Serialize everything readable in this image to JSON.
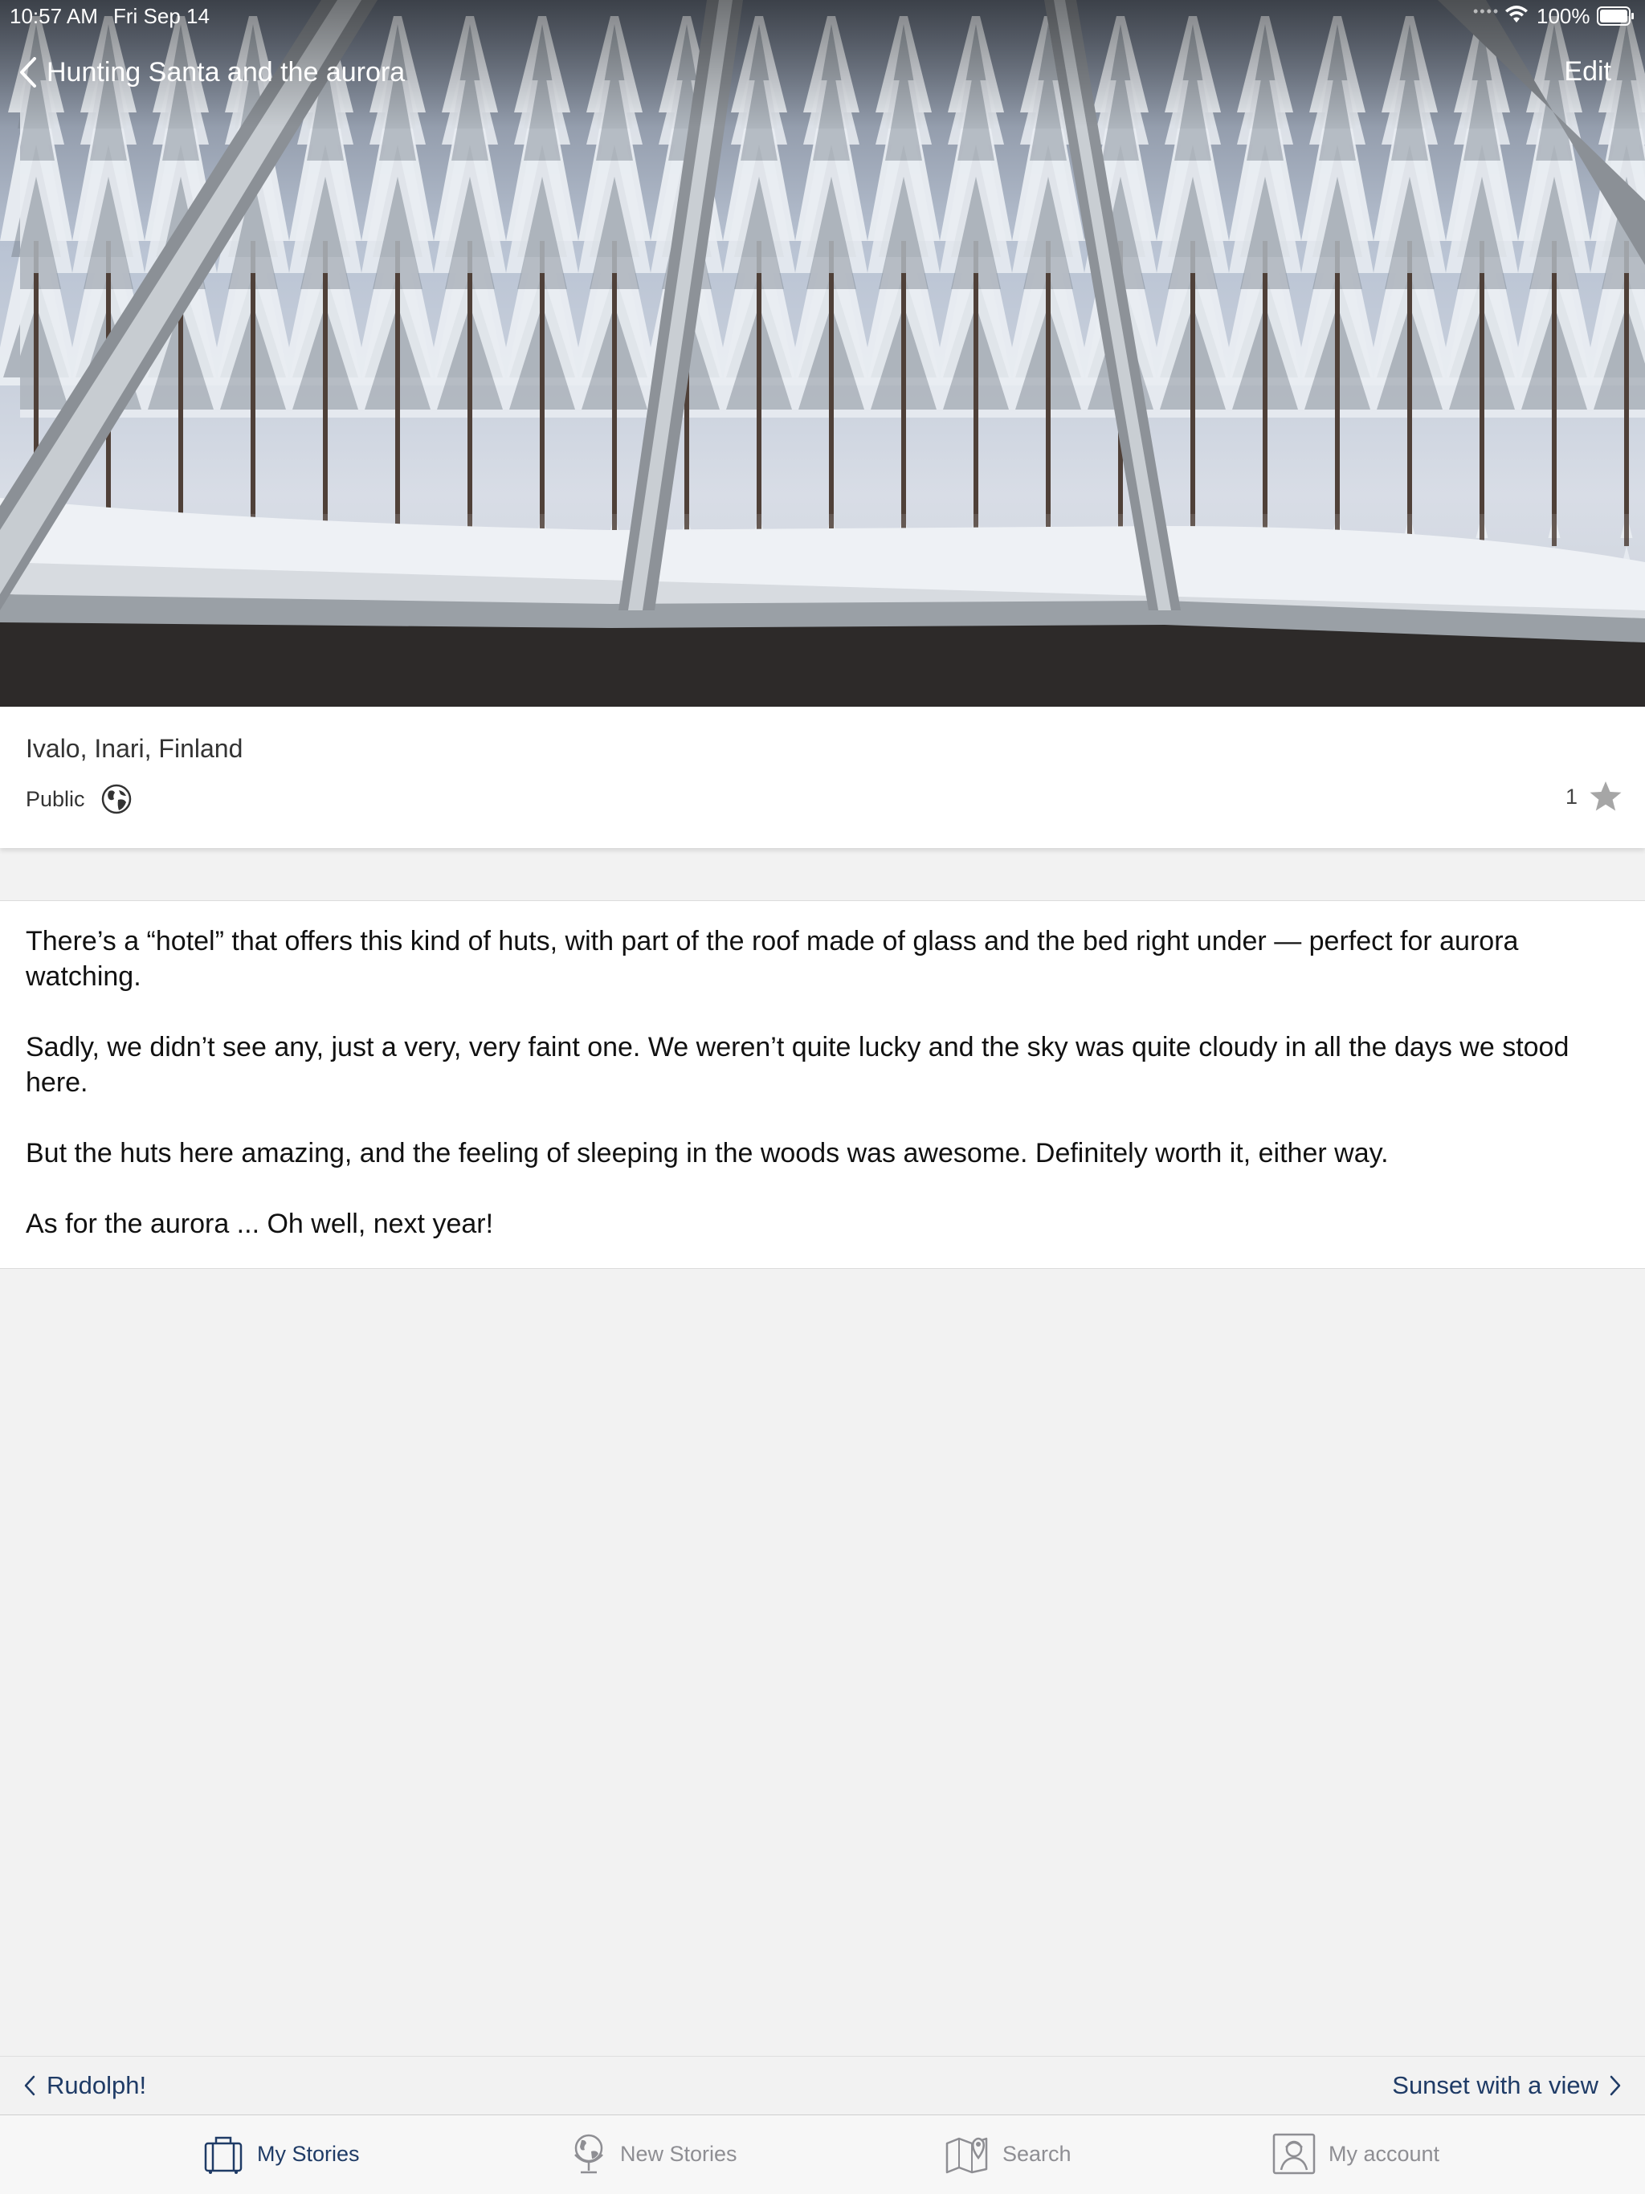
{
  "status_bar": {
    "time": "10:57 AM",
    "date": "Fri Sep 14",
    "battery": "100%"
  },
  "nav": {
    "back_label": "Hunting Santa and the aurora",
    "edit_label": "Edit"
  },
  "story": {
    "location": "Ivalo, Inari, Finland",
    "visibility": "Public",
    "likes": "1",
    "paragraphs": [
      "There’s a “hotel” that offers this kind of huts, with part of the roof made of glass and the bed right under — perfect for aurora watching.",
      "Sadly, we didn’t see any, just a very, very faint one. We weren’t quite lucky and the sky was quite cloudy in all the days we stood here.",
      "But the huts here amazing, and the feeling of sleeping in the woods was awesome. Definitely worth it, either way.",
      "As for the aurora ... Oh well, next year!"
    ]
  },
  "story_nav": {
    "prev_label": "Rudolph!",
    "next_label": "Sunset with a view"
  },
  "tabs": [
    {
      "label": "My Stories",
      "icon": "suitcase-icon",
      "active": true
    },
    {
      "label": "New Stories",
      "icon": "globe-icon",
      "active": false
    },
    {
      "label": "Search",
      "icon": "map-pin-icon",
      "active": false
    },
    {
      "label": "My account",
      "icon": "user-icon",
      "active": false
    }
  ],
  "colors": {
    "accent": "#1f3b66",
    "inactive_tab": "#8e8e93",
    "background": "#f2f2f2"
  }
}
